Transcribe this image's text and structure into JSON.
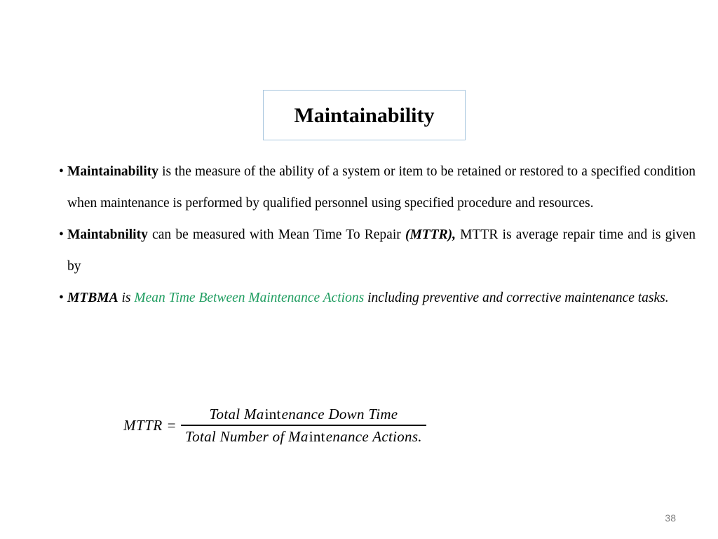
{
  "slide": {
    "title": "Maintainability",
    "page_number": "38",
    "accent_colors": {
      "title_border": "#a8c6de",
      "highlight_green": "#1f9d60",
      "page_number_gray": "#7f7f7f"
    },
    "bullets": [
      {
        "marker": "•",
        "segments": [
          {
            "text": "Maintainability",
            "style": "bold"
          },
          {
            "text": "  is the measure of the ability of a system or item to be retained or restored to a specified condition when maintenance is performed by qualified personnel using specified procedure and resources.",
            "style": "regular"
          }
        ]
      },
      {
        "marker": "•",
        "segments": [
          {
            "text": "Maintabnility",
            "style": "bold"
          },
          {
            "text": " can be measured with Mean Time To Repair ",
            "style": "regular"
          },
          {
            "text": "(MTTR),",
            "style": "bold-italic"
          },
          {
            "text": " MTTR is average repair time and is given by",
            "style": "regular"
          }
        ]
      },
      {
        "marker": "•",
        "segments": [
          {
            "text": "MTBMA",
            "style": "bold-italic"
          },
          {
            "text": " is ",
            "style": "italic"
          },
          {
            "text": "Mean Time Between Maintenance Actions",
            "style": "italic-green"
          },
          {
            "text": " including preventive and corrective maintenance tasks.",
            "style": "italic"
          }
        ]
      }
    ],
    "equation": {
      "lhs": "MTTR =",
      "numerator": {
        "part1": "Total Ma",
        "upright": "int",
        "part2": "enance Down Time"
      },
      "denominator": {
        "part1": "Total Number of  Ma",
        "upright": "int",
        "part2": "enance Actions."
      }
    }
  }
}
